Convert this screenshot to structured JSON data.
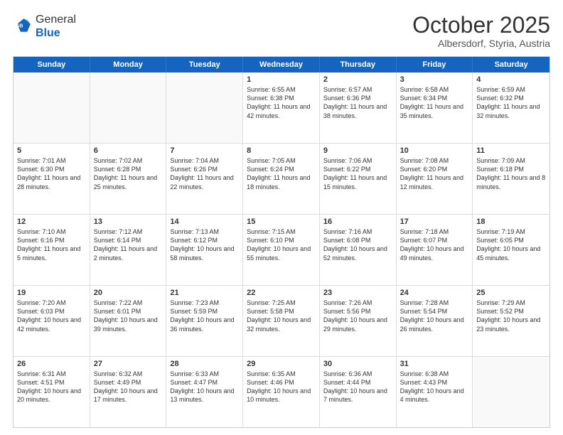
{
  "header": {
    "logo": {
      "line1": "General",
      "line2": "Blue"
    },
    "title": "October 2025",
    "subtitle": "Albersdorf, Styria, Austria"
  },
  "days_of_week": [
    "Sunday",
    "Monday",
    "Tuesday",
    "Wednesday",
    "Thursday",
    "Friday",
    "Saturday"
  ],
  "rows": [
    [
      {
        "day": "",
        "empty": true
      },
      {
        "day": "",
        "empty": true
      },
      {
        "day": "",
        "empty": true
      },
      {
        "day": "1",
        "sunrise": "6:55 AM",
        "sunset": "6:38 PM",
        "daylight": "11 hours and 42 minutes."
      },
      {
        "day": "2",
        "sunrise": "6:57 AM",
        "sunset": "6:36 PM",
        "daylight": "11 hours and 38 minutes."
      },
      {
        "day": "3",
        "sunrise": "6:58 AM",
        "sunset": "6:34 PM",
        "daylight": "11 hours and 35 minutes."
      },
      {
        "day": "4",
        "sunrise": "6:59 AM",
        "sunset": "6:32 PM",
        "daylight": "11 hours and 32 minutes."
      }
    ],
    [
      {
        "day": "5",
        "sunrise": "7:01 AM",
        "sunset": "6:30 PM",
        "daylight": "11 hours and 28 minutes."
      },
      {
        "day": "6",
        "sunrise": "7:02 AM",
        "sunset": "6:28 PM",
        "daylight": "11 hours and 25 minutes."
      },
      {
        "day": "7",
        "sunrise": "7:04 AM",
        "sunset": "6:26 PM",
        "daylight": "11 hours and 22 minutes."
      },
      {
        "day": "8",
        "sunrise": "7:05 AM",
        "sunset": "6:24 PM",
        "daylight": "11 hours and 18 minutes."
      },
      {
        "day": "9",
        "sunrise": "7:06 AM",
        "sunset": "6:22 PM",
        "daylight": "11 hours and 15 minutes."
      },
      {
        "day": "10",
        "sunrise": "7:08 AM",
        "sunset": "6:20 PM",
        "daylight": "11 hours and 12 minutes."
      },
      {
        "day": "11",
        "sunrise": "7:09 AM",
        "sunset": "6:18 PM",
        "daylight": "11 hours and 8 minutes."
      }
    ],
    [
      {
        "day": "12",
        "sunrise": "7:10 AM",
        "sunset": "6:16 PM",
        "daylight": "11 hours and 5 minutes."
      },
      {
        "day": "13",
        "sunrise": "7:12 AM",
        "sunset": "6:14 PM",
        "daylight": "11 hours and 2 minutes."
      },
      {
        "day": "14",
        "sunrise": "7:13 AM",
        "sunset": "6:12 PM",
        "daylight": "10 hours and 58 minutes."
      },
      {
        "day": "15",
        "sunrise": "7:15 AM",
        "sunset": "6:10 PM",
        "daylight": "10 hours and 55 minutes."
      },
      {
        "day": "16",
        "sunrise": "7:16 AM",
        "sunset": "6:08 PM",
        "daylight": "10 hours and 52 minutes."
      },
      {
        "day": "17",
        "sunrise": "7:18 AM",
        "sunset": "6:07 PM",
        "daylight": "10 hours and 49 minutes."
      },
      {
        "day": "18",
        "sunrise": "7:19 AM",
        "sunset": "6:05 PM",
        "daylight": "10 hours and 45 minutes."
      }
    ],
    [
      {
        "day": "19",
        "sunrise": "7:20 AM",
        "sunset": "6:03 PM",
        "daylight": "10 hours and 42 minutes."
      },
      {
        "day": "20",
        "sunrise": "7:22 AM",
        "sunset": "6:01 PM",
        "daylight": "10 hours and 39 minutes."
      },
      {
        "day": "21",
        "sunrise": "7:23 AM",
        "sunset": "5:59 PM",
        "daylight": "10 hours and 36 minutes."
      },
      {
        "day": "22",
        "sunrise": "7:25 AM",
        "sunset": "5:58 PM",
        "daylight": "10 hours and 32 minutes."
      },
      {
        "day": "23",
        "sunrise": "7:26 AM",
        "sunset": "5:56 PM",
        "daylight": "10 hours and 29 minutes."
      },
      {
        "day": "24",
        "sunrise": "7:28 AM",
        "sunset": "5:54 PM",
        "daylight": "10 hours and 26 minutes."
      },
      {
        "day": "25",
        "sunrise": "7:29 AM",
        "sunset": "5:52 PM",
        "daylight": "10 hours and 23 minutes."
      }
    ],
    [
      {
        "day": "26",
        "sunrise": "6:31 AM",
        "sunset": "4:51 PM",
        "daylight": "10 hours and 20 minutes."
      },
      {
        "day": "27",
        "sunrise": "6:32 AM",
        "sunset": "4:49 PM",
        "daylight": "10 hours and 17 minutes."
      },
      {
        "day": "28",
        "sunrise": "6:33 AM",
        "sunset": "4:47 PM",
        "daylight": "10 hours and 13 minutes."
      },
      {
        "day": "29",
        "sunrise": "6:35 AM",
        "sunset": "4:46 PM",
        "daylight": "10 hours and 10 minutes."
      },
      {
        "day": "30",
        "sunrise": "6:36 AM",
        "sunset": "4:44 PM",
        "daylight": "10 hours and 7 minutes."
      },
      {
        "day": "31",
        "sunrise": "6:38 AM",
        "sunset": "4:43 PM",
        "daylight": "10 hours and 4 minutes."
      },
      {
        "day": "",
        "empty": true
      }
    ]
  ]
}
